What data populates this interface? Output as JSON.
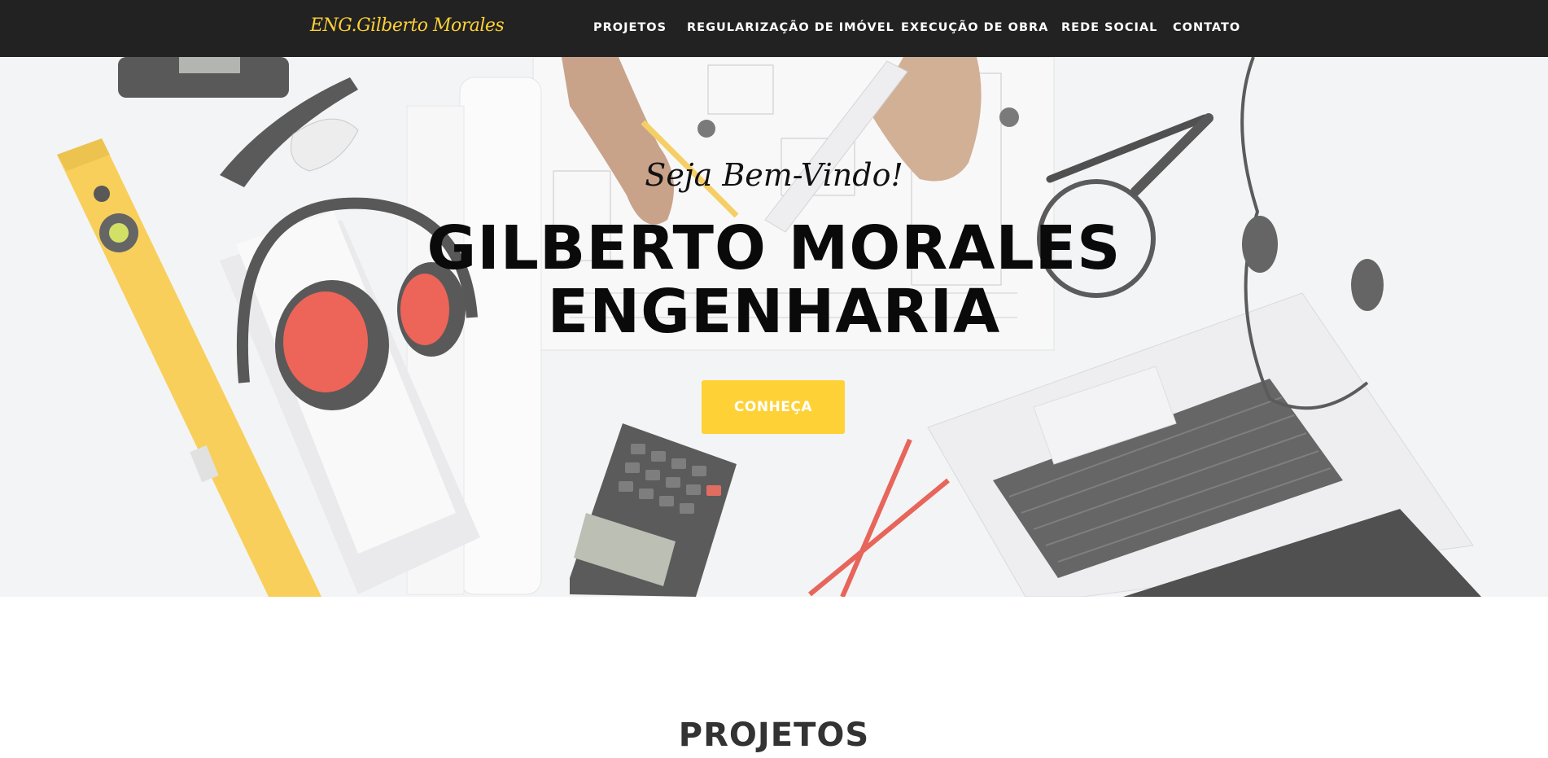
{
  "brand": {
    "name": "ENG.Gilberto Morales",
    "color": "#fed136"
  },
  "nav": {
    "items": [
      {
        "label": "PROJETOS"
      },
      {
        "label": "REGULARIZAÇÃO DE IMÓVEL"
      },
      {
        "label": "EXECUÇÃO DE OBRA"
      },
      {
        "label": "REDE SOCIAL"
      },
      {
        "label": "CONTATO"
      }
    ]
  },
  "hero": {
    "lead": "Seja Bem-Vindo!",
    "heading_line1": "GILBERTO MORALES",
    "heading_line2": "ENGENHARIA",
    "cta_label": "CONHEÇA"
  },
  "sections": {
    "projects_title": "PROJETOS"
  },
  "colors": {
    "accent": "#fed136",
    "navbar": "#222222",
    "heading": "#0a0a0a"
  }
}
